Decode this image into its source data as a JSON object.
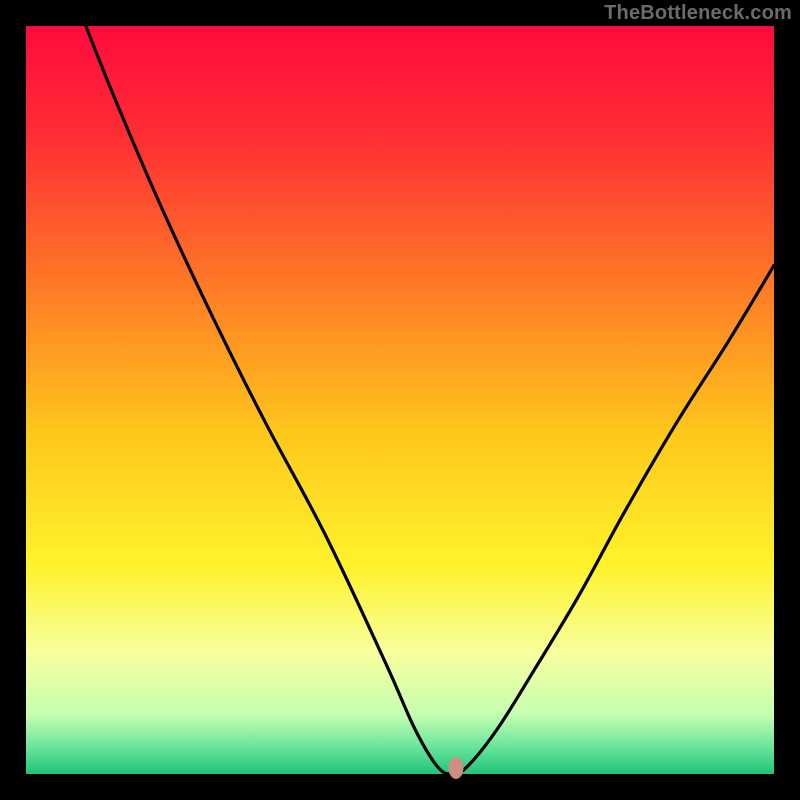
{
  "watermark": "TheBottleneck.com",
  "chart_data": {
    "type": "line",
    "title": "",
    "xlabel": "",
    "ylabel": "",
    "xlim": [
      0,
      100
    ],
    "ylim": [
      0,
      100
    ],
    "grid": false,
    "legend": false,
    "series": [
      {
        "name": "bottleneck-curve",
        "x": [
          8,
          12,
          18,
          25,
          32,
          40,
          48,
          52,
          55,
          57,
          59,
          63,
          68,
          74,
          80,
          87,
          94,
          100
        ],
        "values": [
          100,
          90,
          76,
          61,
          47,
          32,
          15,
          6,
          1,
          0,
          1,
          6,
          14,
          24,
          35,
          47,
          58,
          68
        ]
      }
    ],
    "annotations": [
      {
        "name": "pink-marker",
        "x": 57.5,
        "y": 0
      }
    ],
    "background_gradient": {
      "stops": [
        {
          "pos": 0.0,
          "color": "#ff0b3d"
        },
        {
          "pos": 0.15,
          "color": "#ff2e34"
        },
        {
          "pos": 0.35,
          "color": "#ff7b26"
        },
        {
          "pos": 0.55,
          "color": "#ffc91c"
        },
        {
          "pos": 0.72,
          "color": "#fff22a"
        },
        {
          "pos": 0.84,
          "color": "#f7ffa0"
        },
        {
          "pos": 0.92,
          "color": "#c6ffb0"
        },
        {
          "pos": 0.965,
          "color": "#66e49a"
        },
        {
          "pos": 1.0,
          "color": "#1fc47a"
        }
      ]
    }
  }
}
